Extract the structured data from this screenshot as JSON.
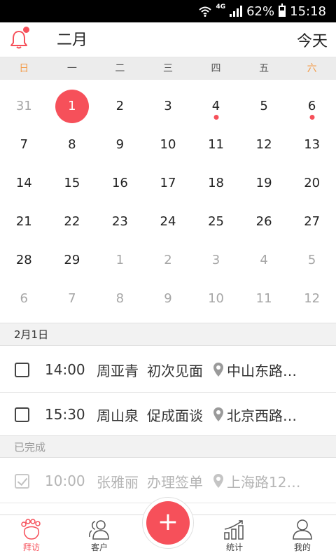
{
  "status_bar": {
    "network": "4G",
    "battery": "62%",
    "time": "15:18"
  },
  "header": {
    "month": "二月",
    "today_label": "今天"
  },
  "weekdays": [
    "日",
    "一",
    "二",
    "三",
    "四",
    "五",
    "六"
  ],
  "calendar": {
    "weeks": [
      [
        {
          "d": "31",
          "muted": true
        },
        {
          "d": "1",
          "selected": true
        },
        {
          "d": "2"
        },
        {
          "d": "3"
        },
        {
          "d": "4",
          "dot": true
        },
        {
          "d": "5"
        },
        {
          "d": "6",
          "dot": true
        }
      ],
      [
        {
          "d": "7"
        },
        {
          "d": "8"
        },
        {
          "d": "9"
        },
        {
          "d": "10"
        },
        {
          "d": "11"
        },
        {
          "d": "12"
        },
        {
          "d": "13"
        }
      ],
      [
        {
          "d": "14"
        },
        {
          "d": "15"
        },
        {
          "d": "16"
        },
        {
          "d": "17"
        },
        {
          "d": "18"
        },
        {
          "d": "19"
        },
        {
          "d": "20"
        }
      ],
      [
        {
          "d": "21"
        },
        {
          "d": "22"
        },
        {
          "d": "23"
        },
        {
          "d": "24"
        },
        {
          "d": "25"
        },
        {
          "d": "26"
        },
        {
          "d": "27"
        }
      ],
      [
        {
          "d": "28"
        },
        {
          "d": "29"
        },
        {
          "d": "1",
          "muted": true
        },
        {
          "d": "2",
          "muted": true
        },
        {
          "d": "3",
          "muted": true
        },
        {
          "d": "4",
          "muted": true
        },
        {
          "d": "5",
          "muted": true
        }
      ],
      [
        {
          "d": "6",
          "muted": true
        },
        {
          "d": "7",
          "muted": true
        },
        {
          "d": "8",
          "muted": true
        },
        {
          "d": "9",
          "muted": true
        },
        {
          "d": "10",
          "muted": true
        },
        {
          "d": "11",
          "muted": true
        },
        {
          "d": "12",
          "muted": true
        }
      ]
    ]
  },
  "schedule": {
    "date_label": "2月1日",
    "tasks": [
      {
        "time": "14:00",
        "name": "周亚青",
        "type": "初次见面",
        "location": "中山东路…"
      },
      {
        "time": "15:30",
        "name": "周山泉",
        "type": "促成面谈",
        "location": "北京西路…"
      }
    ],
    "completed_label": "已完成",
    "completed": [
      {
        "time": "10:00",
        "name": "张雅丽",
        "type": "办理签单",
        "location": "上海路12…"
      }
    ]
  },
  "tabbar": {
    "visit": "拜访",
    "customers": "客户",
    "add": "+",
    "stats": "统计",
    "mine": "我的"
  },
  "colors": {
    "accent": "#f6505a",
    "weekend": "#f39c4a",
    "muted": "#a6a6a6"
  }
}
